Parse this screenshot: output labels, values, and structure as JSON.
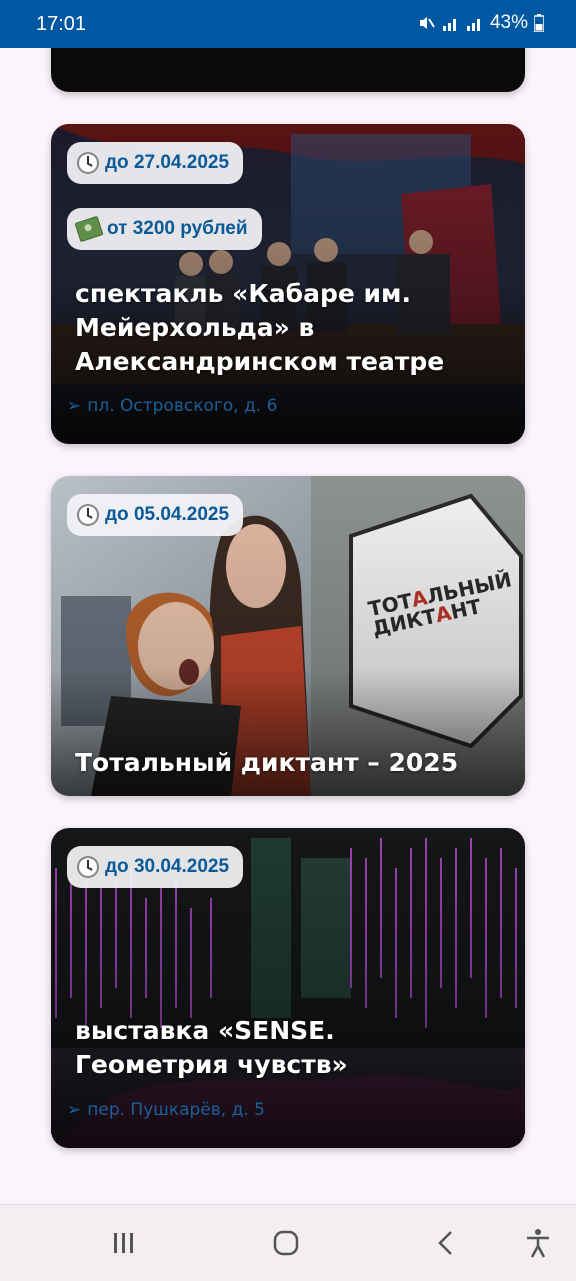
{
  "status": {
    "time": "17:01",
    "battery": "43%"
  },
  "cards": [
    {
      "deadline": "до 27.04.2025",
      "price": "от 3200 рублей",
      "title": "спектакль «Кабаре им. Мейерхольда» в Александринском театре",
      "address": "пл. Островского, д. 6"
    },
    {
      "deadline": "до 05.04.2025",
      "title": "Тотальный диктант – 2025"
    },
    {
      "deadline": "до 30.04.2025",
      "title": "выставка «SENSE. Геометрия чувств»",
      "address": "пер. Пушкарёв, д. 5"
    }
  ],
  "icons": {
    "deadline": "clock-icon",
    "price": "money-icon",
    "address": "arrow-right-icon",
    "nav": [
      "recent-apps-icon",
      "home-icon",
      "back-icon",
      "accessibility-icon"
    ]
  },
  "colors": {
    "statusbar": "#0058a3",
    "badge_text": "#0b5a98",
    "address": "#1c5f99",
    "page_bg": "#fcf4fc"
  }
}
